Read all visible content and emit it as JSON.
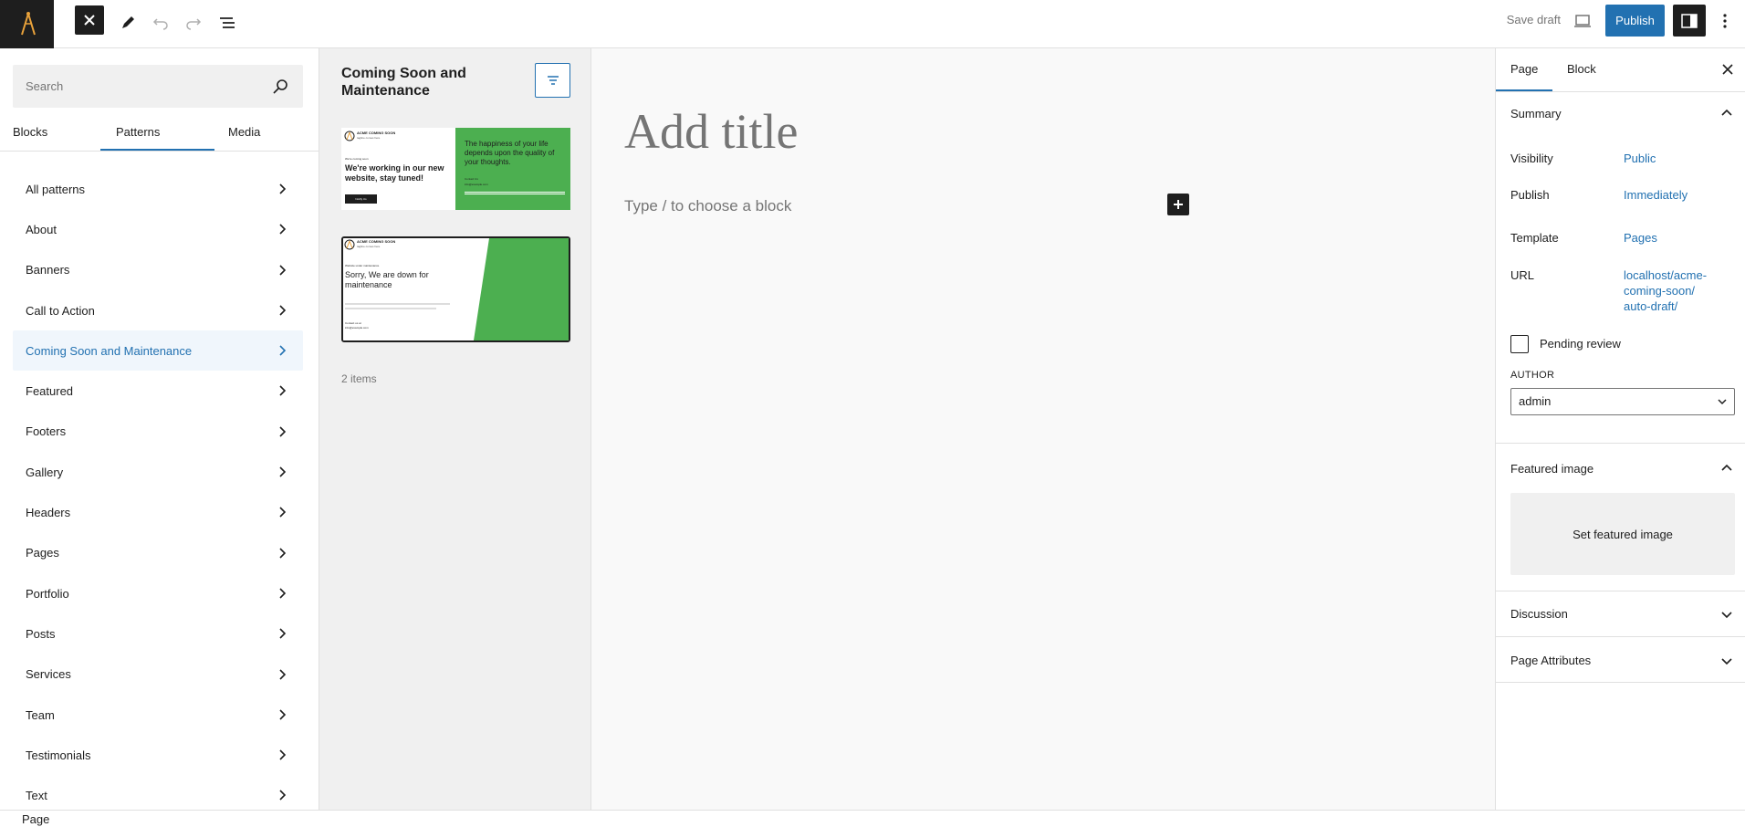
{
  "topbar": {
    "save_draft": "Save draft",
    "publish": "Publish"
  },
  "inserter": {
    "search_placeholder": "Search",
    "tabs": [
      "Blocks",
      "Patterns",
      "Media"
    ],
    "active_tab": "Patterns",
    "categories": [
      "All patterns",
      "About",
      "Banners",
      "Call to Action",
      "Coming Soon and Maintenance",
      "Featured",
      "Footers",
      "Gallery",
      "Headers",
      "Pages",
      "Portfolio",
      "Posts",
      "Services",
      "Team",
      "Testimonials",
      "Text"
    ],
    "active_category": "Coming Soon and Maintenance"
  },
  "patterns": {
    "title": "Coming Soon and Maintenance",
    "items_count": "2 items",
    "thumb1": {
      "brand": "ACME COMING SOON",
      "tagline": "tagline comes here",
      "eyebrow": "We're coming soon",
      "heading": "We're working in our new website, stay tuned!",
      "button": "Notify Us",
      "quote": "The happiness of your life depends upon the quality of your thoughts.",
      "contact_label": "Contact Us",
      "email": "info@example.com"
    },
    "thumb2": {
      "brand": "ACME COMING SOON",
      "tagline": "tagline comes here",
      "eyebrow": "Website under maintenance",
      "heading": "Sorry, We are down for maintenance",
      "contact_label": "Contact us at",
      "email": "info@example.com"
    }
  },
  "editor": {
    "title_placeholder": "Add title",
    "block_placeholder": "Type / to choose a block"
  },
  "sidebar": {
    "tabs": [
      "Page",
      "Block"
    ],
    "summary": "Summary",
    "visibility_label": "Visibility",
    "visibility_value": "Public",
    "publish_label": "Publish",
    "publish_value": "Immediately",
    "template_label": "Template",
    "template_value": "Pages",
    "url_label": "URL",
    "url_value_1": "localhost/acme-",
    "url_value_2": "coming-soon/",
    "url_value_3": "auto-draft/",
    "pending_review": "Pending review",
    "author_label": "AUTHOR",
    "author_value": "admin",
    "featured_image": "Featured image",
    "set_featured_image": "Set featured image",
    "discussion": "Discussion",
    "page_attributes": "Page Attributes"
  },
  "footer": {
    "breadcrumb": "Page"
  },
  "colors": {
    "accent": "#2271b1",
    "pattern_green": "#4caf50",
    "dark": "#1e1e1e"
  }
}
